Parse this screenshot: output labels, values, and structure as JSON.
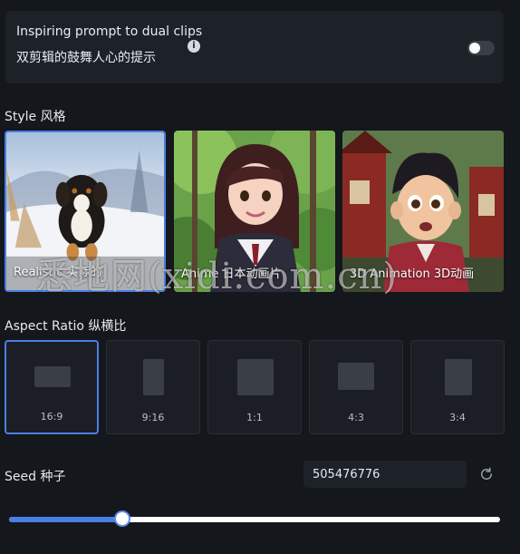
{
  "prompt": {
    "title": "Inspiring prompt to dual clips",
    "subtitle": "双剪辑的鼓舞人心的提示",
    "info_icon": "info-icon",
    "toggle_on": false
  },
  "style_section": {
    "label": "Style 风格",
    "options": [
      {
        "label": "Realistic 实际的",
        "selected": true
      },
      {
        "label": "Anime 日本动画片",
        "selected": false
      },
      {
        "label": "3D Animation 3D动画",
        "selected": false
      }
    ]
  },
  "aspect_section": {
    "label": "Aspect Ratio 纵横比",
    "options": [
      {
        "label": "16:9",
        "selected": true
      },
      {
        "label": "9:16",
        "selected": false
      },
      {
        "label": "1:1",
        "selected": false
      },
      {
        "label": "4:3",
        "selected": false
      },
      {
        "label": "3:4",
        "selected": false
      }
    ]
  },
  "seed_section": {
    "label": "Seed 种子",
    "value": "505476776",
    "refresh_icon": "refresh-icon",
    "slider_fraction": 0.23
  },
  "watermark": "悉地网(xidi.com.cn)",
  "colors": {
    "accent": "#4a7fe3",
    "background": "#14171c",
    "panel": "#1d2128"
  }
}
